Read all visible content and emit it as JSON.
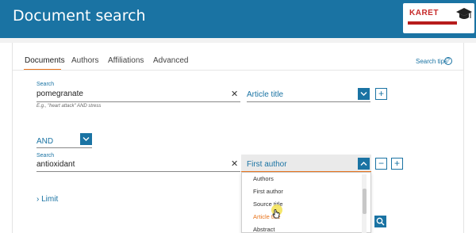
{
  "header": {
    "title": "Document search",
    "logo_text": "KARET",
    "bg_color": "#1a73a3"
  },
  "tabs": [
    {
      "label": "Documents",
      "active": true
    },
    {
      "label": "Authors",
      "active": false
    },
    {
      "label": "Affiliations",
      "active": false
    },
    {
      "label": "Advanced",
      "active": false
    }
  ],
  "search_tips": {
    "label": "Search tips",
    "icon": "help-circle-icon"
  },
  "row1": {
    "field_label": "Search",
    "value": "pomegranate",
    "hint": "E.g., \"heart attack\" AND stress",
    "scope": "Article title"
  },
  "connector": {
    "value": "AND"
  },
  "row2": {
    "field_label": "Search",
    "value": "antioxidant",
    "scope": "First author"
  },
  "scope_options": [
    "Authors",
    "First author",
    "Source title",
    "Article title",
    "Abstract"
  ],
  "hovered_option": "Article title",
  "limit": {
    "label": "Limit"
  },
  "accent_color": "#e8731b"
}
